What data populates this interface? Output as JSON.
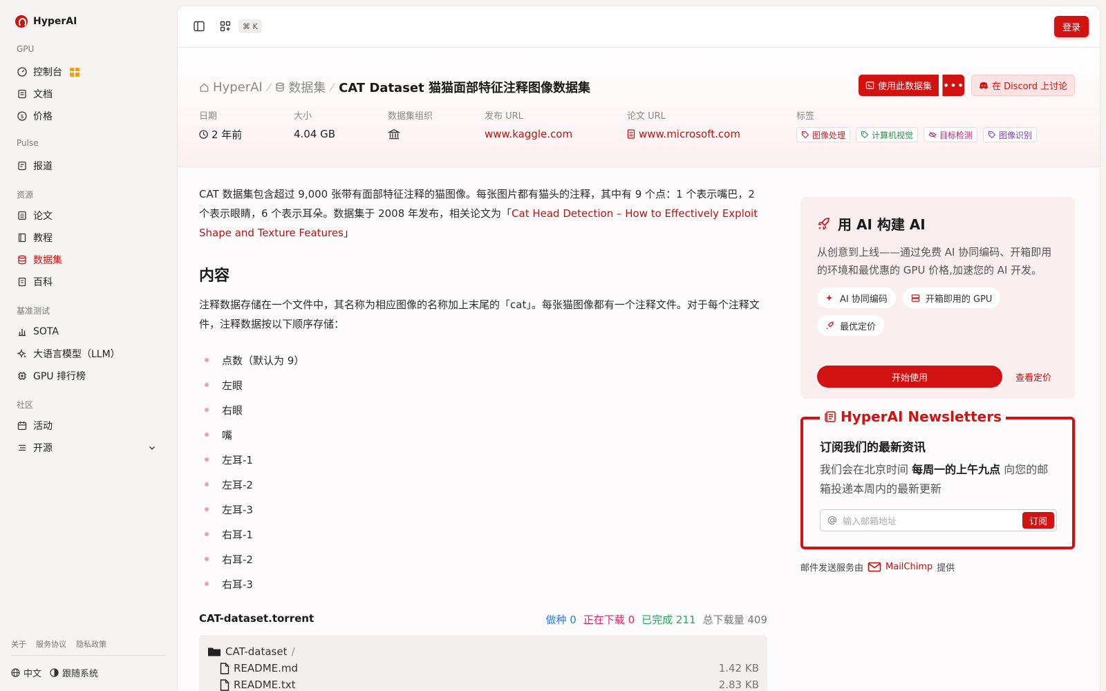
{
  "app": {
    "name": "HyperAI"
  },
  "sidebar": {
    "sections": [
      {
        "label": "GPU",
        "items": [
          {
            "label": "控制台",
            "icon": "gauge-icon"
          },
          {
            "label": "文档",
            "icon": "doc-icon"
          },
          {
            "label": "价格",
            "icon": "dollar-icon"
          }
        ]
      },
      {
        "label": "Pulse",
        "items": [
          {
            "label": "报道",
            "icon": "news-icon"
          }
        ]
      },
      {
        "label": "资源",
        "items": [
          {
            "label": "论文",
            "icon": "paper-icon"
          },
          {
            "label": "教程",
            "icon": "book-icon"
          },
          {
            "label": "数据集",
            "icon": "database-icon",
            "active": true
          },
          {
            "label": "百科",
            "icon": "wiki-icon"
          }
        ]
      },
      {
        "label": "基准测试",
        "items": [
          {
            "label": "SOTA",
            "icon": "chart-icon"
          },
          {
            "label": "大语言模型（LLM）",
            "icon": "sparkle-icon"
          },
          {
            "label": "GPU 排行榜",
            "icon": "chip-icon"
          }
        ]
      },
      {
        "label": "社区",
        "items": [
          {
            "label": "活动",
            "icon": "calendar-icon"
          },
          {
            "label": "开源",
            "icon": "list-icon"
          }
        ]
      }
    ],
    "footer_links": [
      "关于",
      "服务协议",
      "隐私政策"
    ],
    "language": "中文",
    "theme": "跟随系统"
  },
  "topbar": {
    "shortcut": "⌘ K",
    "login": "登录"
  },
  "breadcrumb": {
    "home": "HyperAI",
    "section": "数据集",
    "current": "CAT Dataset 猫猫面部特征注释图像数据集"
  },
  "actions": {
    "use": "使用此数据集",
    "more": "•••",
    "discord": "在 Discord 上讨论"
  },
  "meta": {
    "date_label": "日期",
    "date": "2 年前",
    "size_label": "大小",
    "size": "4.04 GB",
    "org_label": "数据集组织",
    "release_label": "发布 URL",
    "release": "www.kaggle.com",
    "paper_label": "论文 URL",
    "paper": "www.microsoft.com",
    "tags_label": "标签",
    "tags": [
      "图像处理",
      "计算机视觉",
      "目标检测",
      "图像识别"
    ]
  },
  "content": {
    "intro_text": "CAT 数据集包含超过 9,000 张带有面部特征注释的猫图像。每张图片都有猫头的注释，其中有 9 个点：1 个表示嘴巴，2 个表示眼睛，6 个表示耳朵。数据集于 2008 年发布，相关论文为「",
    "intro_link": "Cat Head Detection – How to Effectively Exploit Shape and Texture Features",
    "intro_end": "」",
    "heading": "内容",
    "body": "注释数据存储在一个文件中，其名称为相应图像的名称加上末尾的「cat」。每张猫图像都有一个注释文件。对于每个注释文件，注释数据按以下顺序存储：",
    "bullets": [
      "点数（默认为 9）",
      "左眼",
      "右眼",
      "嘴",
      "左耳-1",
      "左耳-2",
      "左耳-3",
      "右耳-1",
      "右耳-2",
      "右耳-3"
    ]
  },
  "torrent": {
    "name": "CAT-dataset.torrent",
    "seed_label": "做种",
    "seed": "0",
    "downloading_label": "正在下载",
    "downloading": "0",
    "done_label": "已完成",
    "done": "211",
    "total_label": "总下载量",
    "total": "409",
    "folder": "CAT-dataset",
    "files": [
      {
        "name": "README.md",
        "size": "1.42 KB"
      },
      {
        "name": "README.txt",
        "size": "2.83 KB"
      }
    ]
  },
  "ai_card": {
    "title": "用 AI 构建 AI",
    "desc": "从创意到上线——通过免费 AI 协同编码、开箱即用的环境和最优惠的 GPU 价格,加速您的 AI 开发。",
    "chips": [
      "AI 协同编码",
      "开箱即用的 GPU",
      "最优定价"
    ],
    "start": "开始使用",
    "pricing": "查看定价"
  },
  "newsletter": {
    "legend": "HyperAI Newsletters",
    "heading": "订阅我们的最新资讯",
    "text_pre": "我们会在北京时间 ",
    "text_bold": "每周一的上午九点",
    "text_post": " 向您的邮箱投递本周内的最新更新",
    "placeholder": "输入邮箱地址",
    "subscribe": "订阅",
    "provider_pre": "邮件发送服务由",
    "provider": "MailChimp",
    "provider_post": "提供"
  },
  "colors": {
    "accent": "#d21111",
    "seed": "#2f7de1",
    "downloading": "#d9236a",
    "done": "#1fa862"
  }
}
